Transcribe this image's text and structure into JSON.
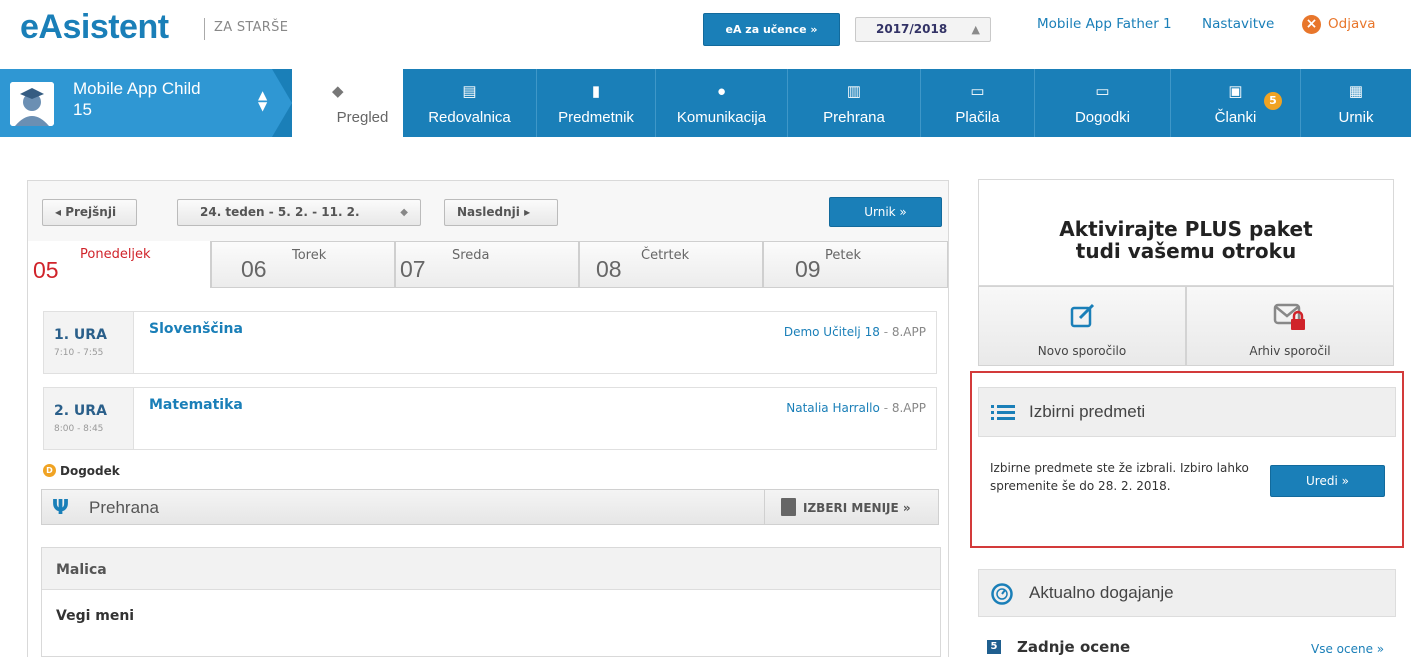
{
  "header": {
    "logo": "eAsistent",
    "logo_sub": "ZA STARŠE",
    "ea_button": "eA za učence »",
    "school_year": "2017/2018",
    "user_link": "Mobile App Father 1",
    "settings_link": "Nastavitve",
    "logout_link": "Odjava"
  },
  "nav": {
    "child_name_line1": "Mobile App Child",
    "child_name_line2": "15",
    "items": [
      {
        "label": "Pregled",
        "icon": "cube-icon"
      },
      {
        "label": "Redovalnica",
        "icon": "id-card-icon"
      },
      {
        "label": "Predmetnik",
        "icon": "book-icon"
      },
      {
        "label": "Komunikacija",
        "icon": "chat-icon"
      },
      {
        "label": "Prehrana",
        "icon": "food-icon"
      },
      {
        "label": "Plačila",
        "icon": "payment-card-icon"
      },
      {
        "label": "Dogodki",
        "icon": "event-card-icon"
      },
      {
        "label": "Članki",
        "icon": "articles-icon"
      },
      {
        "label": "Urnik",
        "icon": "calendar-icon"
      }
    ],
    "articles_badge": "5"
  },
  "schedule": {
    "prev_button": "◂ Prejšnji",
    "week_select": "24. teden - 5. 2. - 11. 2.",
    "next_button": "Naslednji ▸",
    "urnik_button": "Urnik »",
    "days": [
      {
        "num": "05",
        "name": "Ponedeljek",
        "active": true
      },
      {
        "num": "06",
        "name": "Torek",
        "active": false
      },
      {
        "num": "07",
        "name": "Sreda",
        "active": false
      },
      {
        "num": "08",
        "name": "Četrtek",
        "active": false
      },
      {
        "num": "09",
        "name": "Petek",
        "active": false
      }
    ],
    "lessons": [
      {
        "ura": "1. URA",
        "time": "7:10 - 7:55",
        "subject": "Slovenščina",
        "teacher": "Demo Učitelj 18",
        "dash": "-",
        "class": "8.APP"
      },
      {
        "ura": "2. URA",
        "time": "8:00 - 8:45",
        "subject": "Matematika",
        "teacher": "Natalia Harrallo",
        "dash": "-",
        "class": "8.APP"
      }
    ],
    "event_label": "Dogodek",
    "event_icon_text": "D"
  },
  "meals": {
    "title": "Prehrana",
    "choose_menu": "IZBERI MENIJE »",
    "malica_title": "Malica",
    "malica_item": "Vegi meni"
  },
  "sidebar": {
    "plus_line1": "Aktivirajte PLUS paket",
    "plus_line2": "tudi vašemu otroku",
    "new_message": "Novo sporočilo",
    "message_archive": "Arhiv sporočil",
    "elective_title": "Izbirni predmeti",
    "elective_text": "Izbirne predmete ste že izbrali. Izbiro lahko spremenite še do 28. 2. 2018.",
    "edit_button": "Uredi »",
    "news_title": "Aktualno dogajanje",
    "grades_icon_text": "5",
    "grades_title": "Zadnje ocene",
    "grades_link": "Vse ocene »"
  },
  "colors": {
    "brand_blue": "#1a7fb8",
    "active_day_red": "#d0232a",
    "highlight_outline": "#d33a3a",
    "badge_orange": "#f0a323",
    "logout_orange": "#e8762b"
  }
}
